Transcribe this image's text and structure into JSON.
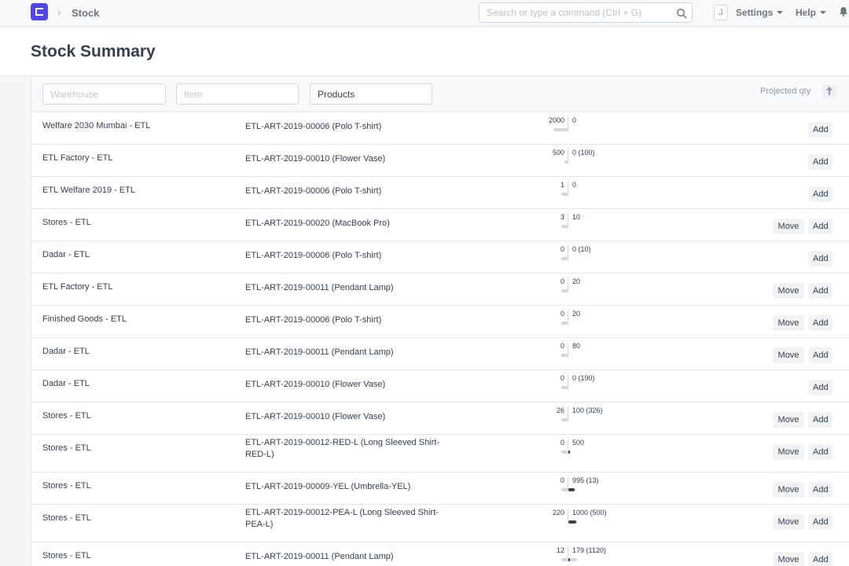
{
  "navbar": {
    "breadcrumb": "Stock",
    "search_placeholder": "Search or type a command (Ctrl + G)",
    "avatar_initial": "J",
    "settings_label": "Settings",
    "help_label": "Help"
  },
  "page": {
    "title": "Stock Summary"
  },
  "filters": {
    "warehouse_placeholder": "Warehouse",
    "item_placeholder": "Item",
    "group_value": "Products",
    "sort_label": "Projected qty"
  },
  "buttons": {
    "move": "Move",
    "add": "Add"
  },
  "rows": [
    {
      "warehouse": "Welfare 2030 Mumbai - ETL",
      "item": "ETL-ART-2019-00006 (Polo T-shirt)",
      "qty_left": "2000",
      "qty_right": "0",
      "move": false
    },
    {
      "warehouse": "ETL Factory - ETL",
      "item": "ETL-ART-2019-00010 (Flower Vase)",
      "qty_left": "500",
      "qty_right": "0 (100)",
      "move": false
    },
    {
      "warehouse": "ETL Welfare 2019 - ETL",
      "item": "ETL-ART-2019-00006 (Polo T-shirt)",
      "qty_left": "1",
      "qty_right": "0",
      "move": false
    },
    {
      "warehouse": "Stores - ETL",
      "item": "ETL-ART-2019-00020 (MacBook Pro)",
      "qty_left": "3",
      "qty_right": "10",
      "move": true
    },
    {
      "warehouse": "Dadar - ETL",
      "item": "ETL-ART-2019-00006 (Polo T-shirt)",
      "qty_left": "0",
      "qty_right": "0 (10)",
      "move": false
    },
    {
      "warehouse": "ETL Factory - ETL",
      "item": "ETL-ART-2019-00011 (Pendant Lamp)",
      "qty_left": "0",
      "qty_right": "20",
      "move": true
    },
    {
      "warehouse": "Finished Goods - ETL",
      "item": "ETL-ART-2019-00006 (Polo T-shirt)",
      "qty_left": "0",
      "qty_right": "20",
      "move": true
    },
    {
      "warehouse": "Dadar - ETL",
      "item": "ETL-ART-2019-00011 (Pendant Lamp)",
      "qty_left": "0",
      "qty_right": "80",
      "move": true
    },
    {
      "warehouse": "Dadar - ETL",
      "item": "ETL-ART-2019-00010 (Flower Vase)",
      "qty_left": "0",
      "qty_right": "0 (190)",
      "move": false
    },
    {
      "warehouse": "Stores - ETL",
      "item": "ETL-ART-2019-00010 (Flower Vase)",
      "qty_left": "26",
      "qty_right": "100 (326)",
      "move": true
    },
    {
      "warehouse": "Stores - ETL",
      "item": "ETL-ART-2019-00012-RED-L (Long Sleeved Shirt-RED-L)",
      "qty_left": "0",
      "qty_right": "500",
      "move": true
    },
    {
      "warehouse": "Stores - ETL",
      "item": "ETL-ART-2019-00009-YEL (Umbrella-YEL)",
      "qty_left": "0",
      "qty_right": "995 (13)",
      "move": true
    },
    {
      "warehouse": "Stores - ETL",
      "item": "ETL-ART-2019-00012-PEA-L (Long Sleeved Shirt-PEA-L)",
      "qty_left": "220",
      "qty_right": "1000 (500)",
      "move": true
    },
    {
      "warehouse": "Stores - ETL",
      "item": "ETL-ART-2019-00011 (Pendant Lamp)",
      "qty_left": "12",
      "qty_right": "179 (1120)",
      "move": true
    }
  ]
}
